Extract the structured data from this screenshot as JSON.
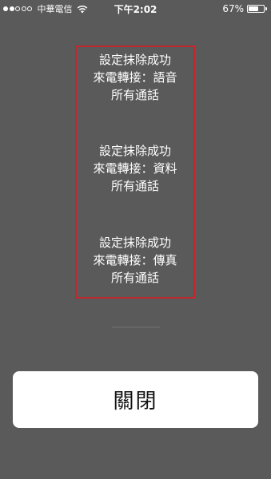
{
  "status_bar": {
    "carrier": "中華電信",
    "time": "下午2:02",
    "battery_percent": "67%",
    "battery_level": 0.67,
    "signal_strength": 2,
    "signal_max": 5,
    "icons": [
      "signal-dots-icon",
      "wifi-icon",
      "battery-icon"
    ]
  },
  "messages": [
    {
      "line1": "設定抹除成功",
      "line2": "來電轉接：語音",
      "line3": "所有通話"
    },
    {
      "line1": "設定抹除成功",
      "line2": "來電轉接：資料",
      "line3": "所有通話"
    },
    {
      "line1": "設定抹除成功",
      "line2": "來電轉接：傳真",
      "line3": "所有通話"
    }
  ],
  "close_button": {
    "label": "關閉"
  },
  "colors": {
    "background": "#5a5a5a",
    "highlight_border": "#c1272d",
    "text": "#ffffff",
    "button_bg": "#ffffff"
  }
}
